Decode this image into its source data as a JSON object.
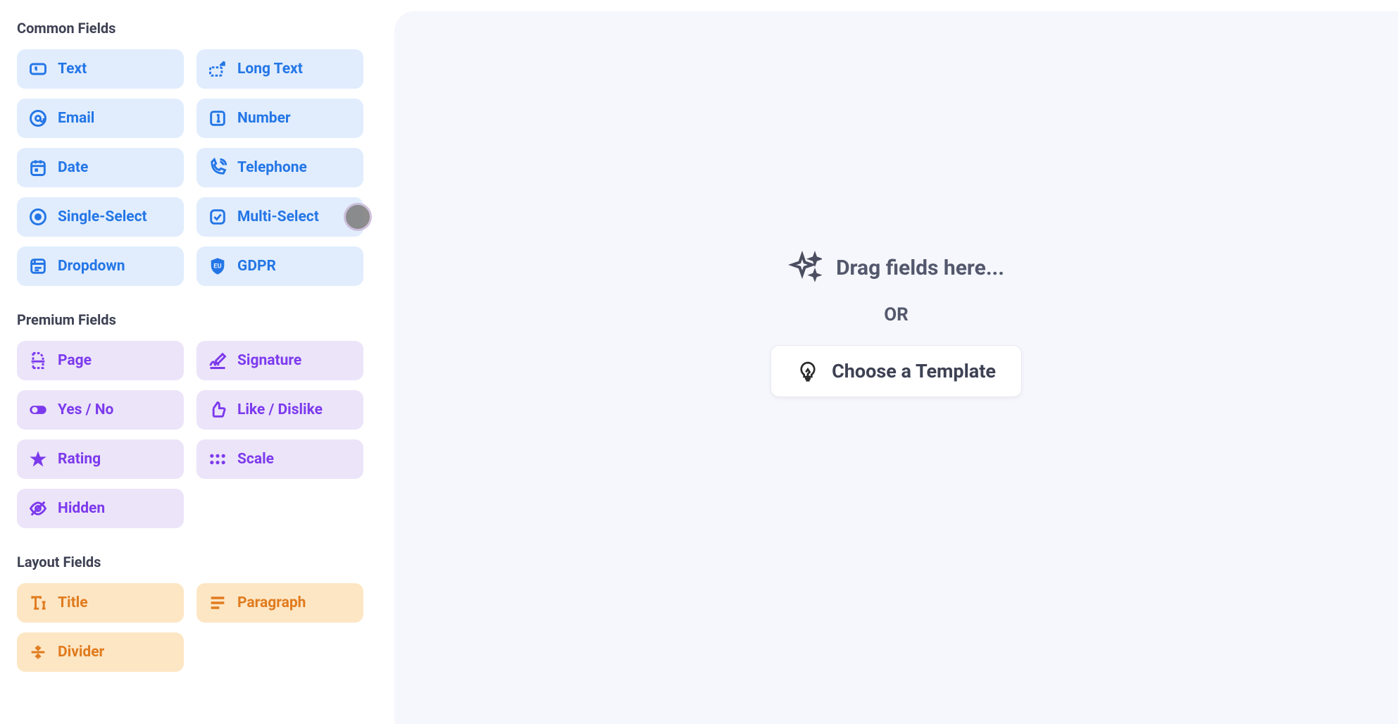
{
  "sections": {
    "common": {
      "title": "Common Fields"
    },
    "premium": {
      "title": "Premium Fields"
    },
    "layout": {
      "title": "Layout Fields"
    }
  },
  "common_fields": [
    {
      "label": "Text",
      "icon": "text"
    },
    {
      "label": "Long Text",
      "icon": "long-text"
    },
    {
      "label": "Email",
      "icon": "email"
    },
    {
      "label": "Number",
      "icon": "number"
    },
    {
      "label": "Date",
      "icon": "date"
    },
    {
      "label": "Telephone",
      "icon": "telephone"
    },
    {
      "label": "Single-Select",
      "icon": "single-select"
    },
    {
      "label": "Multi-Select",
      "icon": "multi-select"
    },
    {
      "label": "Dropdown",
      "icon": "dropdown"
    },
    {
      "label": "GDPR",
      "icon": "gdpr"
    }
  ],
  "premium_fields": [
    {
      "label": "Page",
      "icon": "page"
    },
    {
      "label": "Signature",
      "icon": "signature"
    },
    {
      "label": "Yes / No",
      "icon": "toggle"
    },
    {
      "label": "Like / Dislike",
      "icon": "thumb"
    },
    {
      "label": "Rating",
      "icon": "star"
    },
    {
      "label": "Scale",
      "icon": "scale"
    },
    {
      "label": "Hidden",
      "icon": "hidden"
    }
  ],
  "layout_fields": [
    {
      "label": "Title",
      "icon": "title"
    },
    {
      "label": "Paragraph",
      "icon": "paragraph"
    },
    {
      "label": "Divider",
      "icon": "divider"
    }
  ],
  "canvas": {
    "drag_text": "Drag fields here...",
    "or": "OR",
    "template_button": "Choose a Template"
  }
}
